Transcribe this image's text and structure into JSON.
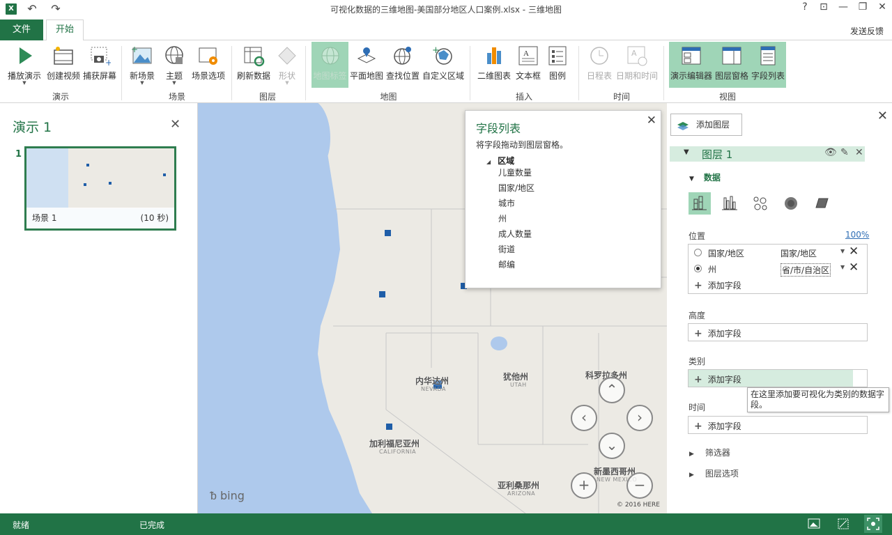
{
  "window": {
    "title": "可视化数据的三维地图-美国部分地区人口案例.xlsx - 三维地图",
    "app_icon": "X",
    "undo_icon": "undo-icon",
    "redo_icon": "redo-icon",
    "help": "?",
    "restore": "⊡",
    "minimize": "—",
    "maximize": "❐",
    "close": "✕"
  },
  "tabs": {
    "file": "文件",
    "home": "开始",
    "feedback": "发送反馈"
  },
  "ribbon": {
    "groups": {
      "tour": "演示",
      "scene": "场景",
      "layer": "图层",
      "map": "地图",
      "insert": "插入",
      "time": "时间",
      "view": "视图"
    },
    "buttons": {
      "play_tour": "播放演示",
      "create_video": "创建视频",
      "capture_screen": "捕获屏幕",
      "new_scene": "新场景",
      "theme": "主题",
      "scene_options": "场景选项",
      "refresh_data": "刷新数据",
      "shapes": "形状",
      "map_labels": "地图标签",
      "flat_map": "平面地图",
      "find_location": "查找位置",
      "custom_regions": "自定义区域",
      "2d_chart": "二维图表",
      "text_box": "文本框",
      "legend": "图例",
      "timeline": "日程表",
      "date_time": "日期和时间",
      "tour_editor": "演示编辑器",
      "layer_pane": "图层窗格",
      "field_list": "字段列表"
    }
  },
  "left_panel": {
    "title": "演示 1",
    "close": "✕",
    "scene_number": "1",
    "scene_name": "场景 1",
    "scene_duration": "(10 秒)"
  },
  "map": {
    "labels": {
      "nevada": "内华达州",
      "nevada_en": "NEVADA",
      "utah": "犹他州",
      "utah_en": "UTAH",
      "colorado": "科罗拉多州",
      "california": "加利福尼亚州",
      "california_en": "CALIFORNIA",
      "arizona": "亚利桑那州",
      "arizona_en": "ARIZONA",
      "new_mexico": "新墨西哥州",
      "new_mexico_en": "NEW MEXICO"
    },
    "bing": "bing",
    "copyright": "© 2016 HERE",
    "nav": {
      "up": "⌃",
      "left": "‹",
      "right": "›",
      "down": "⌄",
      "zoom_in": "+",
      "zoom_out": "−"
    }
  },
  "field_list": {
    "title": "字段列表",
    "close": "✕",
    "hint": "将字段拖动到图层窗格。",
    "group": "区域",
    "fields": [
      "儿童数量",
      "国家/地区",
      "城市",
      "州",
      "成人数量",
      "街道",
      "邮编"
    ]
  },
  "right_panel": {
    "add_layer": "添加图层",
    "close": "✕",
    "layer_name": "图层 1",
    "data_section": "数据",
    "location_label": "位置",
    "location_percent": "100%",
    "location_rows": [
      {
        "field": "国家/地区",
        "type": "国家/地区",
        "selected": false
      },
      {
        "field": "州",
        "type": "省/市/自治区",
        "selected": true
      }
    ],
    "add_field": "添加字段",
    "height_label": "高度",
    "category_label": "类别",
    "time_label": "时间",
    "filters": "筛选器",
    "layer_options": "图层选项",
    "tooltip": "在这里添加要可视化为类别的数据字段。"
  },
  "status": {
    "ready": "就绪",
    "done": "已完成"
  },
  "colors": {
    "accent": "#217346",
    "active_bg": "#9fd5b7",
    "data_point": "#1f5ea8",
    "water": "#aec9ec"
  }
}
